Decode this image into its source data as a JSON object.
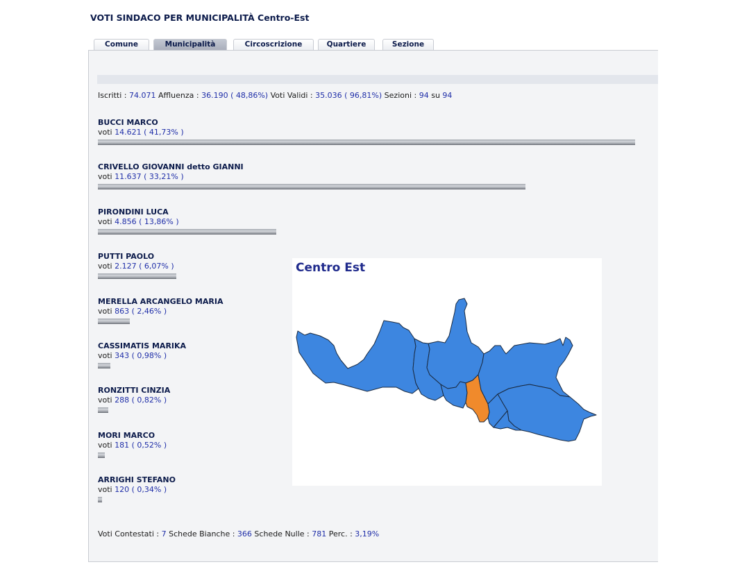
{
  "page": {
    "title": "VOTI SINDACO PER MUNICIPALITÀ Centro-Est"
  },
  "tabs": [
    {
      "label": "Comune",
      "active": false
    },
    {
      "label": "Municipalità",
      "active": true
    },
    {
      "label": "Circoscrizione",
      "active": false
    },
    {
      "label": "Quartiere",
      "active": false
    },
    {
      "label": "Sezione",
      "active": false
    }
  ],
  "stats": {
    "iscritti_label": "Iscritti :",
    "iscritti": "74.071",
    "affluenza_label": "Affluenza :",
    "affluenza": "36.190 ( 48,86%)",
    "validi_label": "Voti Validi :",
    "validi": "35.036 ( 96,81%)",
    "sezioni_label": "Sezioni :",
    "sezioni": "94",
    "su_label": "su",
    "sezioni_tot": "94"
  },
  "votes_prefix": "voti",
  "candidates": [
    {
      "name": "BUCCI MARCO",
      "votes": "14.621",
      "percent": "( 41,73% )",
      "share": 41.73
    },
    {
      "name": "CRIVELLO GIOVANNI detto GIANNI",
      "votes": "11.637",
      "percent": "( 33,21% )",
      "share": 33.21
    },
    {
      "name": "PIRONDINI LUCA",
      "votes": "4.856",
      "percent": "( 13,86% )",
      "share": 13.86
    },
    {
      "name": "PUTTI PAOLO",
      "votes": "2.127",
      "percent": "( 6,07% )",
      "share": 6.07
    },
    {
      "name": "MERELLA ARCANGELO MARIA",
      "votes": "863",
      "percent": "( 2,46% )",
      "share": 2.46
    },
    {
      "name": "CASSIMATIS MARIKA",
      "votes": "343",
      "percent": "( 0,98% )",
      "share": 0.98
    },
    {
      "name": "RONZITTI CINZIA",
      "votes": "288",
      "percent": "( 0,82% )",
      "share": 0.82
    },
    {
      "name": "MORI MARCO",
      "votes": "181",
      "percent": "( 0,52% )",
      "share": 0.52
    },
    {
      "name": "ARRIGHI STEFANO",
      "votes": "120",
      "percent": "( 0,34% )",
      "share": 0.34
    }
  ],
  "footer": {
    "contestati_label": "Voti Contestati :",
    "contestati": "7",
    "bianche_label": "Schede Bianche :",
    "bianche": "366",
    "nulle_label": "Schede Nulle :",
    "nulle": "781",
    "perc_label": "Perc. :",
    "perc": "3,19%"
  },
  "map": {
    "title": "Centro Est",
    "colors": {
      "region": "#3d86e0",
      "highlight": "#f08a2c",
      "border": "#1a2a40"
    }
  }
}
